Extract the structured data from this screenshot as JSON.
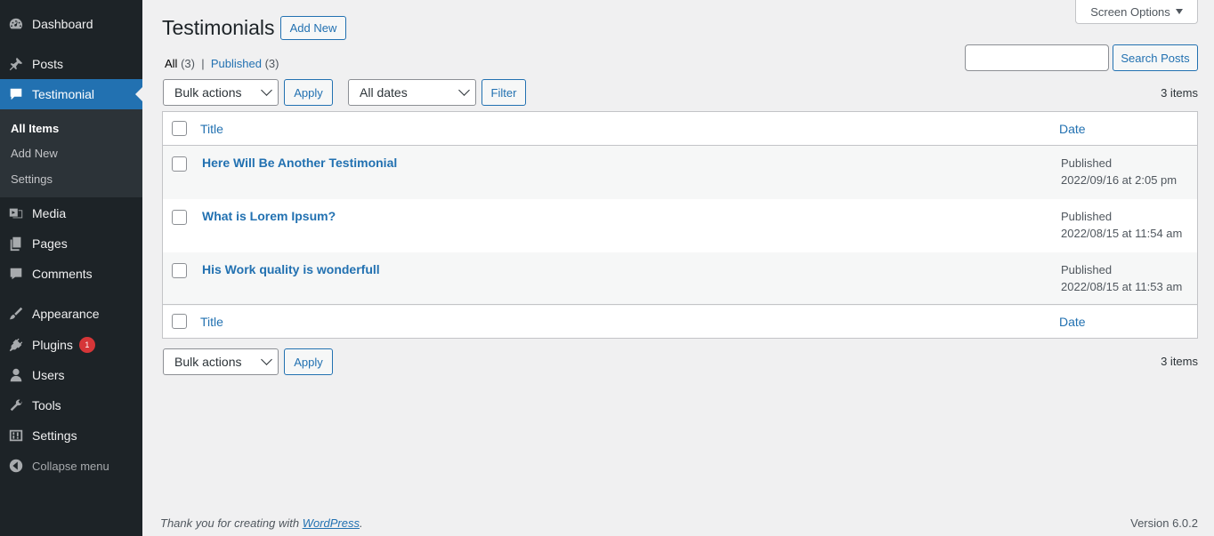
{
  "sidebar": {
    "items": [
      {
        "label": "Dashboard",
        "icon": "dashboard-icon"
      },
      {
        "label": "Posts",
        "icon": "pin-icon"
      },
      {
        "label": "Testimonial",
        "icon": "testimonial-icon"
      },
      {
        "label": "Media",
        "icon": "media-icon"
      },
      {
        "label": "Pages",
        "icon": "pages-icon"
      },
      {
        "label": "Comments",
        "icon": "comments-icon"
      },
      {
        "label": "Appearance",
        "icon": "brush-icon"
      },
      {
        "label": "Plugins",
        "icon": "plugin-icon",
        "badge": "1"
      },
      {
        "label": "Users",
        "icon": "user-icon"
      },
      {
        "label": "Tools",
        "icon": "wrench-icon"
      },
      {
        "label": "Settings",
        "icon": "settings-icon"
      }
    ],
    "submenu": [
      "All Items",
      "Add New",
      "Settings"
    ],
    "collapse_label": "Collapse menu"
  },
  "header": {
    "screen_options": "Screen Options",
    "title": "Testimonials",
    "add_new": "Add New"
  },
  "views": {
    "all": "All",
    "all_count": "(3)",
    "separator": "|",
    "published": "Published",
    "published_count": "(3)"
  },
  "search": {
    "value": "",
    "button": "Search Posts"
  },
  "toolbar": {
    "bulk_actions": "Bulk actions",
    "apply": "Apply",
    "dates": "All dates",
    "filter": "Filter",
    "items_count": "3 items"
  },
  "table": {
    "columns": {
      "title": "Title",
      "date": "Date"
    },
    "rows": [
      {
        "title": "Here Will Be Another Testimonial",
        "status": "Published",
        "date": "2022/09/16 at 2:05 pm"
      },
      {
        "title": "What is Lorem Ipsum?",
        "status": "Published",
        "date": "2022/08/15 at 11:54 am"
      },
      {
        "title": "His Work quality is wonderfull",
        "status": "Published",
        "date": "2022/08/15 at 11:53 am"
      }
    ]
  },
  "footer": {
    "thanks_prefix": "Thank you for creating with ",
    "thanks_link": "WordPress",
    "thanks_suffix": ".",
    "version": "Version 6.0.2"
  },
  "colors": {
    "sidebar_bg": "#1d2327",
    "accent": "#2271b1",
    "badge": "#d63638",
    "page_bg": "#f0f0f1"
  }
}
